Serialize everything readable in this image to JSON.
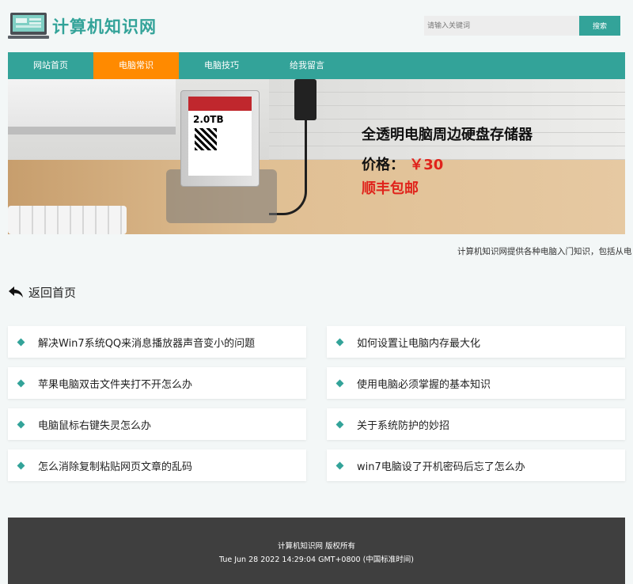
{
  "header": {
    "logo_icon": "computer-monitor-icon",
    "site_title": "计算机知识网",
    "search_placeholder": "请输入关键词",
    "search_button": "搜索"
  },
  "nav": {
    "items": [
      {
        "label": "网站首页",
        "active": false
      },
      {
        "label": "电脑常识",
        "active": true
      },
      {
        "label": "电脑技巧",
        "active": false
      },
      {
        "label": "给我留言",
        "active": false
      }
    ]
  },
  "banner": {
    "drive_capacity": "2.0TB",
    "headline": "全透明电脑周边硬盘存储器",
    "price_label": "价格：",
    "price_value": "￥30",
    "shipping": "顺丰包邮"
  },
  "marquee": {
    "text": "计算机知识网提供各种电脑入门知识，包括从电"
  },
  "back": {
    "icon": "reply-arrow-icon",
    "label": "返回首页"
  },
  "articles": [
    {
      "title": "解决Win7系统QQ来消息播放器声音变小的问题"
    },
    {
      "title": "如何设置让电脑内存最大化"
    },
    {
      "title": "苹果电脑双击文件夹打不开怎么办"
    },
    {
      "title": "使用电脑必须掌握的基本知识"
    },
    {
      "title": "电脑鼠标右键失灵怎么办"
    },
    {
      "title": "关于系统防护的妙招"
    },
    {
      "title": "怎么消除复制粘贴网页文章的乱码"
    },
    {
      "title": "win7电脑设了开机密码后忘了怎么办"
    }
  ],
  "footer": {
    "copyright": "计算机知识网 版权所有",
    "datetime": "Tue Jun 28 2022 14:29:04 GMT+0800 (中国标准时间)"
  },
  "colors": {
    "accent": "#33a399",
    "nav_active": "#ff8a00",
    "price": "#e0231b",
    "footer_bg": "#3f3f3f"
  }
}
